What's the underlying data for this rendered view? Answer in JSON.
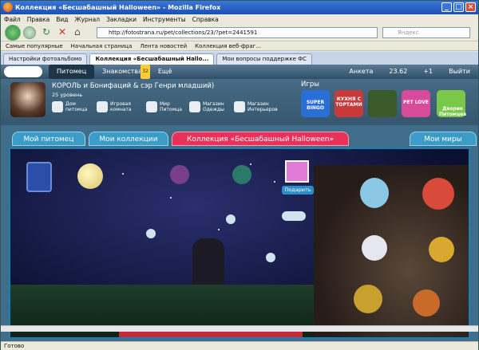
{
  "window": {
    "title": "Коллекция «Бесшабашный Halloween» - Mozilla Firefox"
  },
  "menu": [
    "Файл",
    "Правка",
    "Вид",
    "Журнал",
    "Закладки",
    "Инструменты",
    "Справка"
  ],
  "nav": {
    "url": "http://fotostrana.ru/pet/collections/23/?pet=2441591",
    "search_placeholder": "Яндекс"
  },
  "bookmarks": [
    "Самые популярные",
    "Начальная страница",
    "Лента новостей",
    "Коллекция веб-фраг..."
  ],
  "tabs": [
    "Настройки фотоальбомо",
    "Коллекция «Бесшабашный Hallo...",
    "Мои вопросы поддержке ФС"
  ],
  "site": {
    "nav": [
      "Питомец",
      "Знакомства",
      "Ещё"
    ],
    "dating_badge": "32",
    "right": [
      "Анкета",
      "23.62",
      "+1",
      "Выйти"
    ]
  },
  "profile": {
    "name": "КОРОЛЬ и Бонифаций & сэр Генри младший)",
    "level": "25 уровень",
    "actions": [
      "Дом питомца",
      "Игровая комната",
      "Мир Питомца",
      "Магазин Одежды",
      "Магазин Интерьеров"
    ],
    "games_title": "Игры",
    "games": [
      {
        "label": "SUPER BINGO",
        "color": "#2a6fd8"
      },
      {
        "label": "КУХНЯ С ТОРТАМИ",
        "color": "#c83a3a"
      },
      {
        "label": "",
        "color": "#3a5a2a"
      },
      {
        "label": "PET LOVE",
        "color": "#d84a9a"
      },
      {
        "label": "Дворик Питомцев",
        "color": "#7ac84a"
      }
    ]
  },
  "collection_tabs": [
    "Мой питомец",
    "Мои коллекции",
    "Коллекция «Бесшабашный Halloween»",
    "Мои миры"
  ],
  "scene": {
    "gift_button": "Подарить"
  },
  "status": "Готово"
}
